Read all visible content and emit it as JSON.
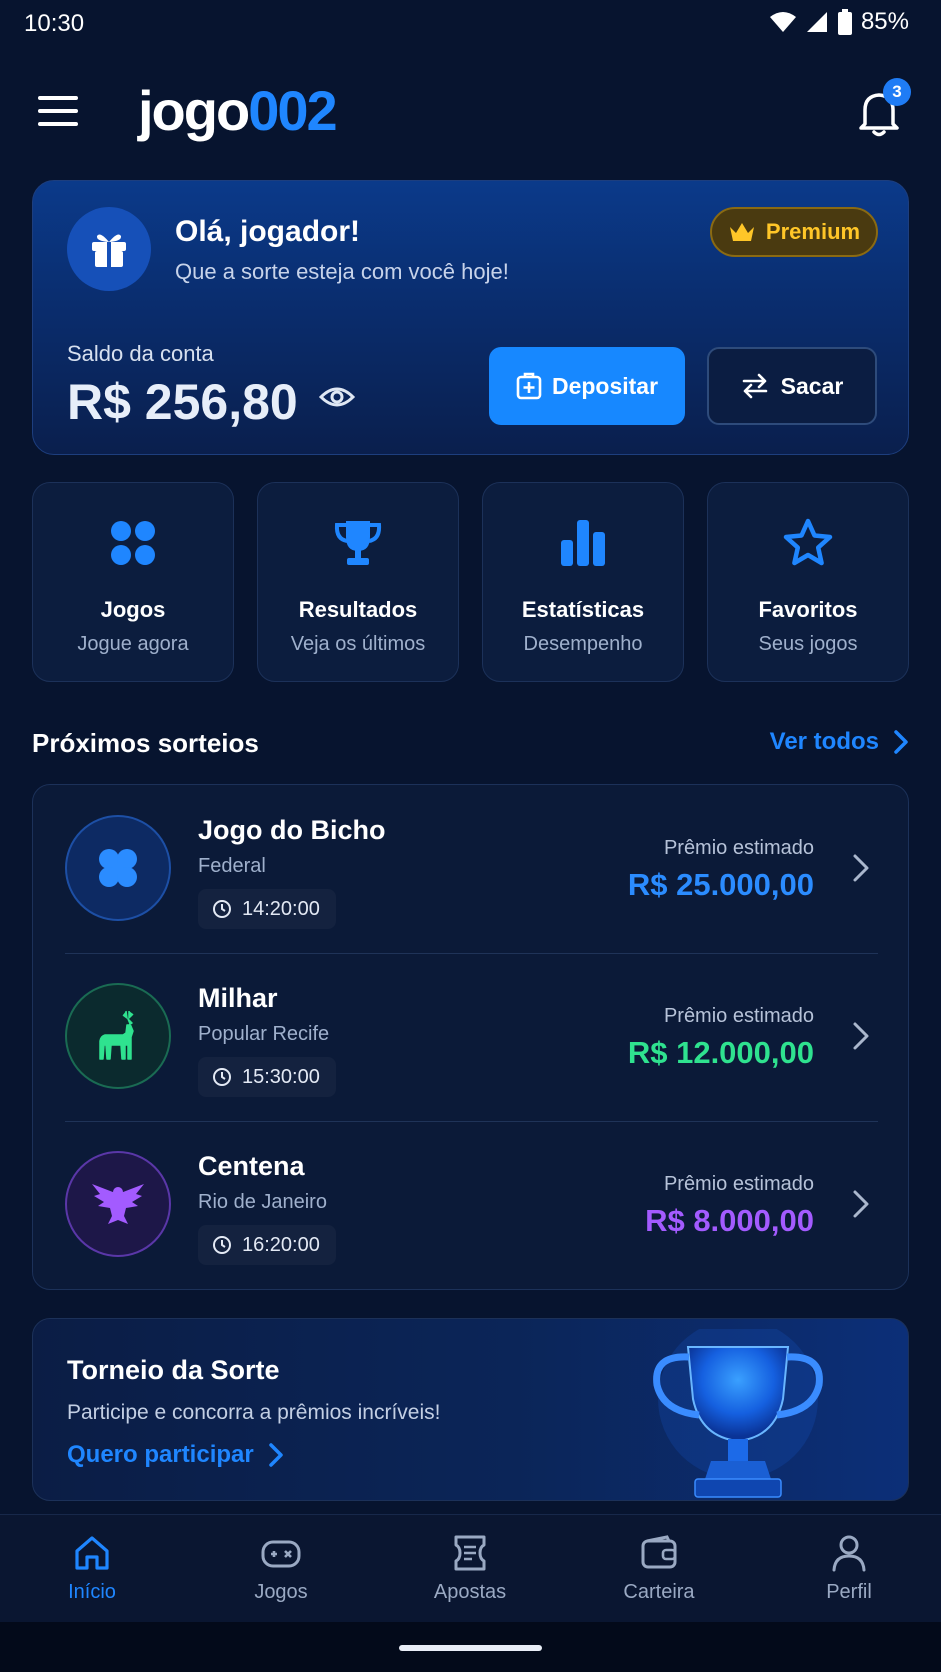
{
  "status_bar": {
    "time": "10:30",
    "battery": "85%"
  },
  "header": {
    "logo_part1": "jogo",
    "logo_part2": "002",
    "notifications_count": "3"
  },
  "hero": {
    "greeting": "Olá, jogador!",
    "subtitle": "Que a sorte esteja com você hoje!",
    "badge": "Premium",
    "balance_label": "Saldo da conta",
    "balance_value": "R$ 256,80",
    "deposit_label": "Depositar",
    "withdraw_label": "Sacar"
  },
  "tiles": [
    {
      "title": "Jogos",
      "subtitle": "Jogue agora",
      "icon": "grid-icon"
    },
    {
      "title": "Resultados",
      "subtitle": "Veja os últimos",
      "icon": "trophy-icon"
    },
    {
      "title": "Estatísticas",
      "subtitle": "Desempenho",
      "icon": "bar-chart-icon"
    },
    {
      "title": "Favoritos",
      "subtitle": "Seus jogos",
      "icon": "star-icon"
    }
  ],
  "draws_section": {
    "title": "Próximos sorteios",
    "see_all": "Ver todos"
  },
  "draws": [
    {
      "name": "Jogo do Bicho",
      "subtitle": "Federal",
      "time": "14:20:00",
      "prize_label": "Prêmio estimado",
      "prize_value": "R$ 25.000,00",
      "color": "#2b8cff",
      "icon": "clover-icon"
    },
    {
      "name": "Milhar",
      "subtitle": "Popular Recife",
      "time": "15:30:00",
      "prize_label": "Prêmio estimado",
      "prize_value": "R$ 12.000,00",
      "color": "#2fe28f",
      "icon": "deer-icon"
    },
    {
      "name": "Centena",
      "subtitle": "Rio de Janeiro",
      "time": "16:20:00",
      "prize_label": "Prêmio estimado",
      "prize_value": "R$ 8.000,00",
      "color": "#a35bff",
      "icon": "eagle-icon"
    }
  ],
  "tournament": {
    "title": "Torneio da Sorte",
    "subtitle": "Participe e concorra a prêmios incríveis!",
    "cta": "Quero participar"
  },
  "bottom_nav": [
    {
      "label": "Início",
      "icon": "home-icon",
      "active": true
    },
    {
      "label": "Jogos",
      "icon": "gamepad-icon",
      "active": false
    },
    {
      "label": "Apostas",
      "icon": "ticket-icon",
      "active": false
    },
    {
      "label": "Carteira",
      "icon": "wallet-icon",
      "active": false
    },
    {
      "label": "Perfil",
      "icon": "user-icon",
      "active": false
    }
  ],
  "colors": {
    "accent": "#1f86ff",
    "background": "#07142f",
    "premium": "#ffc628"
  }
}
